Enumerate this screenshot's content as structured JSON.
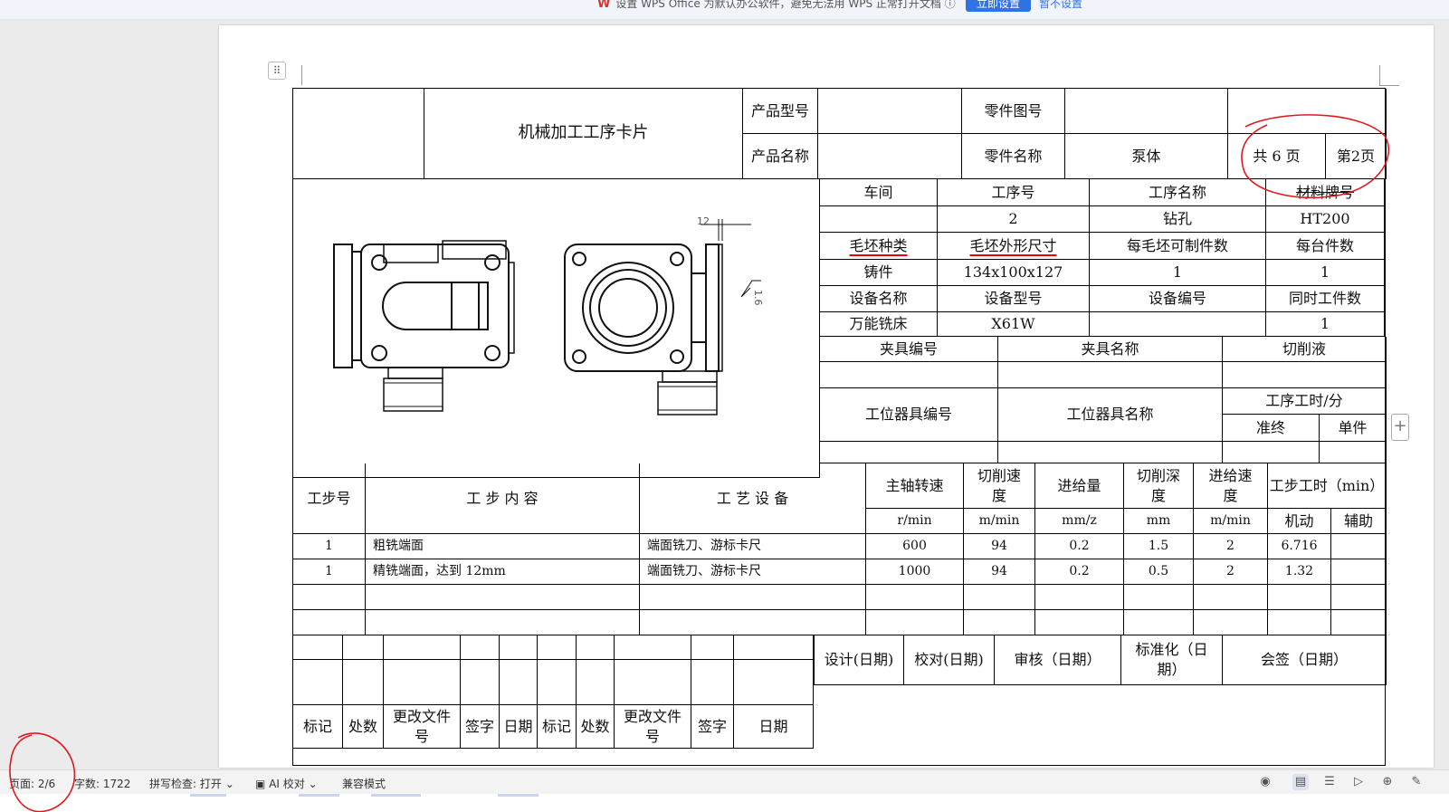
{
  "notification": {
    "message": "设置 WPS Office 为默认办公软件，避免无法用 WPS 正常打开文档",
    "primary_button": "立即设置",
    "secondary_link": "暂不设置"
  },
  "card": {
    "title": "机械加工工序卡片",
    "product_model_label": "产品型号",
    "product_model_value": "",
    "product_name_label": "产品名称",
    "product_name_value": "",
    "part_drawing_no_label": "零件图号",
    "part_drawing_no_value": "",
    "part_name_label": "零件名称",
    "part_name_value": "泵体",
    "total_pages": "共 6 页",
    "current_page": "第2页",
    "info_rows": [
      [
        "车间",
        "工序号",
        "工序名称",
        "材料牌号"
      ],
      [
        "",
        "2",
        "钻孔",
        "HT200"
      ],
      [
        "毛坯种类",
        "毛坯外形尺寸",
        "每毛坯可制件数",
        "每台件数"
      ],
      [
        "铸件",
        "134x100x127",
        "1",
        "1"
      ],
      [
        "设备名称",
        "设备型号",
        "设备编号",
        "同时工件数"
      ],
      [
        "万能铣床",
        "X61W",
        "",
        "1"
      ]
    ],
    "fixture": {
      "no_label": "夹具编号",
      "name_label": "夹具名称",
      "coolant_label": "切削液"
    },
    "station": {
      "no_label": "工位器具编号",
      "name_label": "工位器具名称",
      "time_label": "工序工时/分",
      "prep_label": "准终",
      "unit_label": "单件"
    },
    "drawing": {
      "dim": "12",
      "roughness": "1.6"
    },
    "steps_header": {
      "step_no": "工步号",
      "content": "工 步 内 容",
      "equipment": "工 艺 设 备",
      "spindle": "主轴转速",
      "speed": "切削速度",
      "feed": "进给量",
      "depth": "切削深度",
      "feed_speed": "进给速度",
      "step_time": "工步工时（min）",
      "u_spindle": "r/min",
      "u_speed": "m/min",
      "u_feed": "mm/z",
      "u_depth": "mm",
      "u_feed_speed": "m/min",
      "machine": "机动",
      "aux": "辅助"
    },
    "steps": [
      [
        "1",
        "粗铣端面",
        "端面铣刀、游标卡尺",
        "600",
        "94",
        "0.2",
        "1.5",
        "2",
        "6.716",
        ""
      ],
      [
        "1",
        "精铣端面，达到 12mm",
        "端面铣刀、游标卡尺",
        "1000",
        "94",
        "0.2",
        "0.5",
        "2",
        "1.32",
        ""
      ]
    ],
    "signoff": {
      "design": "设计(日期)",
      "check": "校对(日期)",
      "review": "审核（日期）",
      "standard": "标准化（日期）",
      "countersign": "会签（日期）",
      "mark": "标记",
      "place": "处数",
      "change_doc": "更改文件号",
      "sign": "签字",
      "date": "日期",
      "date2": "日期",
      "mark_short": "标记"
    }
  },
  "statusbar": {
    "page": "页面: 2/6",
    "words": "字数: 1722",
    "spell": "拼写检查: 打开",
    "ai": "AI 校对",
    "mode": "兼容模式"
  }
}
